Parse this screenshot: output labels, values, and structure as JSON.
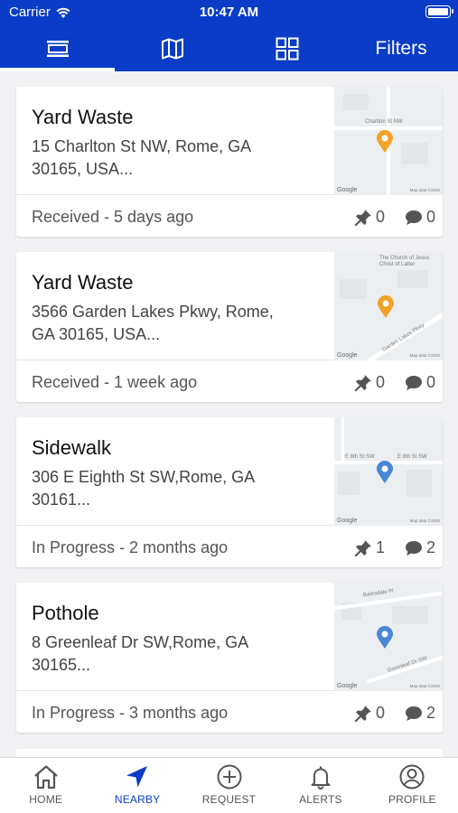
{
  "status_bar": {
    "carrier": "Carrier",
    "time": "10:47 AM"
  },
  "tabs": [
    {
      "icon": "list-icon",
      "active": true
    },
    {
      "icon": "map-icon",
      "active": false
    },
    {
      "icon": "grid-icon",
      "active": false
    }
  ],
  "filters_label": "Filters",
  "requests": [
    {
      "title": "Yard Waste",
      "address": "15 Charlton St NW, Rome, GA 30165, USA...",
      "status": "Received - 5 days ago",
      "pins": "0",
      "comments": "0",
      "pin_color": "#f2a127",
      "map_label_a": "Charlton St NW",
      "map_label_b": ""
    },
    {
      "title": "Yard Waste",
      "address": "3566 Garden Lakes Pkwy, Rome, GA 30165, USA...",
      "status": "Received - 1 week ago",
      "pins": "0",
      "comments": "0",
      "pin_color": "#f2a127",
      "map_label_a": "The Church of Jesus Christ of Latter",
      "map_label_b": "Garden Lakes Pkwy"
    },
    {
      "title": "Sidewalk",
      "address": "306 E Eighth St SW,Rome, GA 30161...",
      "status": "In Progress - 2 months ago",
      "pins": "1",
      "comments": "2",
      "pin_color": "#4a86d6",
      "map_label_a": "E 8th St SW",
      "map_label_b": "E 8th St SW"
    },
    {
      "title": "Pothole",
      "address": "8 Greenleaf Dr SW,Rome, GA 30165...",
      "status": "In Progress - 3 months ago",
      "pins": "0",
      "comments": "2",
      "pin_color": "#4a86d6",
      "map_label_a": "Barksdale Pl",
      "map_label_b": "Greenleaf Dr SW"
    }
  ],
  "map_google_label": "Google",
  "map_copyright": "Map data ©2020",
  "bottom_nav": [
    {
      "label": "HOME",
      "icon": "home-icon",
      "active": false
    },
    {
      "label": "NEARBY",
      "icon": "navigation-arrow-icon",
      "active": true
    },
    {
      "label": "REQUEST",
      "icon": "plus-circle-icon",
      "active": false
    },
    {
      "label": "ALERTS",
      "icon": "bell-icon",
      "active": false
    },
    {
      "label": "PROFILE",
      "icon": "user-circle-icon",
      "active": false
    }
  ],
  "colors": {
    "brand": "#0a3cc7",
    "background": "#f2f2f4",
    "pin_orange": "#f2a127",
    "pin_blue": "#4a86d6"
  }
}
